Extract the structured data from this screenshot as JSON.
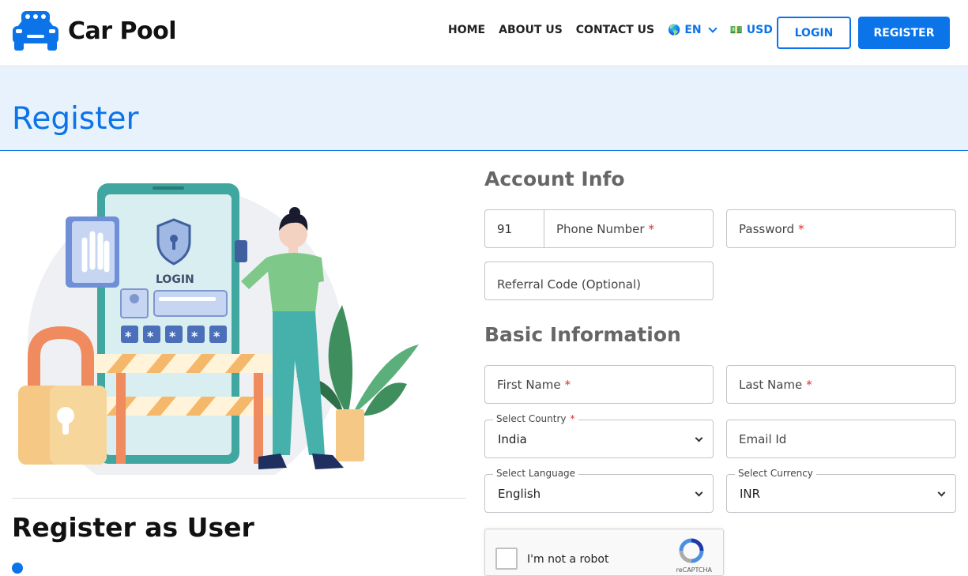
{
  "header": {
    "brand": "Car Pool",
    "nav": [
      "HOME",
      "ABOUT US",
      "CONTACT US"
    ],
    "language": {
      "flag": "🌎",
      "value": "EN"
    },
    "currency": {
      "flag": "💵",
      "value": "USD"
    },
    "login_label": "LOGIN",
    "register_label": "REGISTER"
  },
  "banner": {
    "title": "Register"
  },
  "left": {
    "illustration_label": "LOGIN",
    "heading": "Register as User"
  },
  "form": {
    "account_title": "Account Info",
    "phone_prefix": "91",
    "phone_placeholder": "Phone Number",
    "password_placeholder": "Password",
    "referral_placeholder": "Referral Code (Optional)",
    "basic_title": "Basic Information",
    "first_name_placeholder": "First Name",
    "last_name_placeholder": "Last Name",
    "country_label": "Select Country",
    "country_value": "India",
    "email_placeholder": "Email Id",
    "language_label": "Select Language",
    "language_value": "English",
    "currency_label": "Select Currency",
    "currency_value": "INR",
    "required_mark": "*"
  },
  "captcha": {
    "label": "I'm not a robot",
    "brand": "reCAPTCHA"
  },
  "colors": {
    "accent": "#0b74e8",
    "banner_bg": "#e8f2fd",
    "required": "#d9302c"
  }
}
